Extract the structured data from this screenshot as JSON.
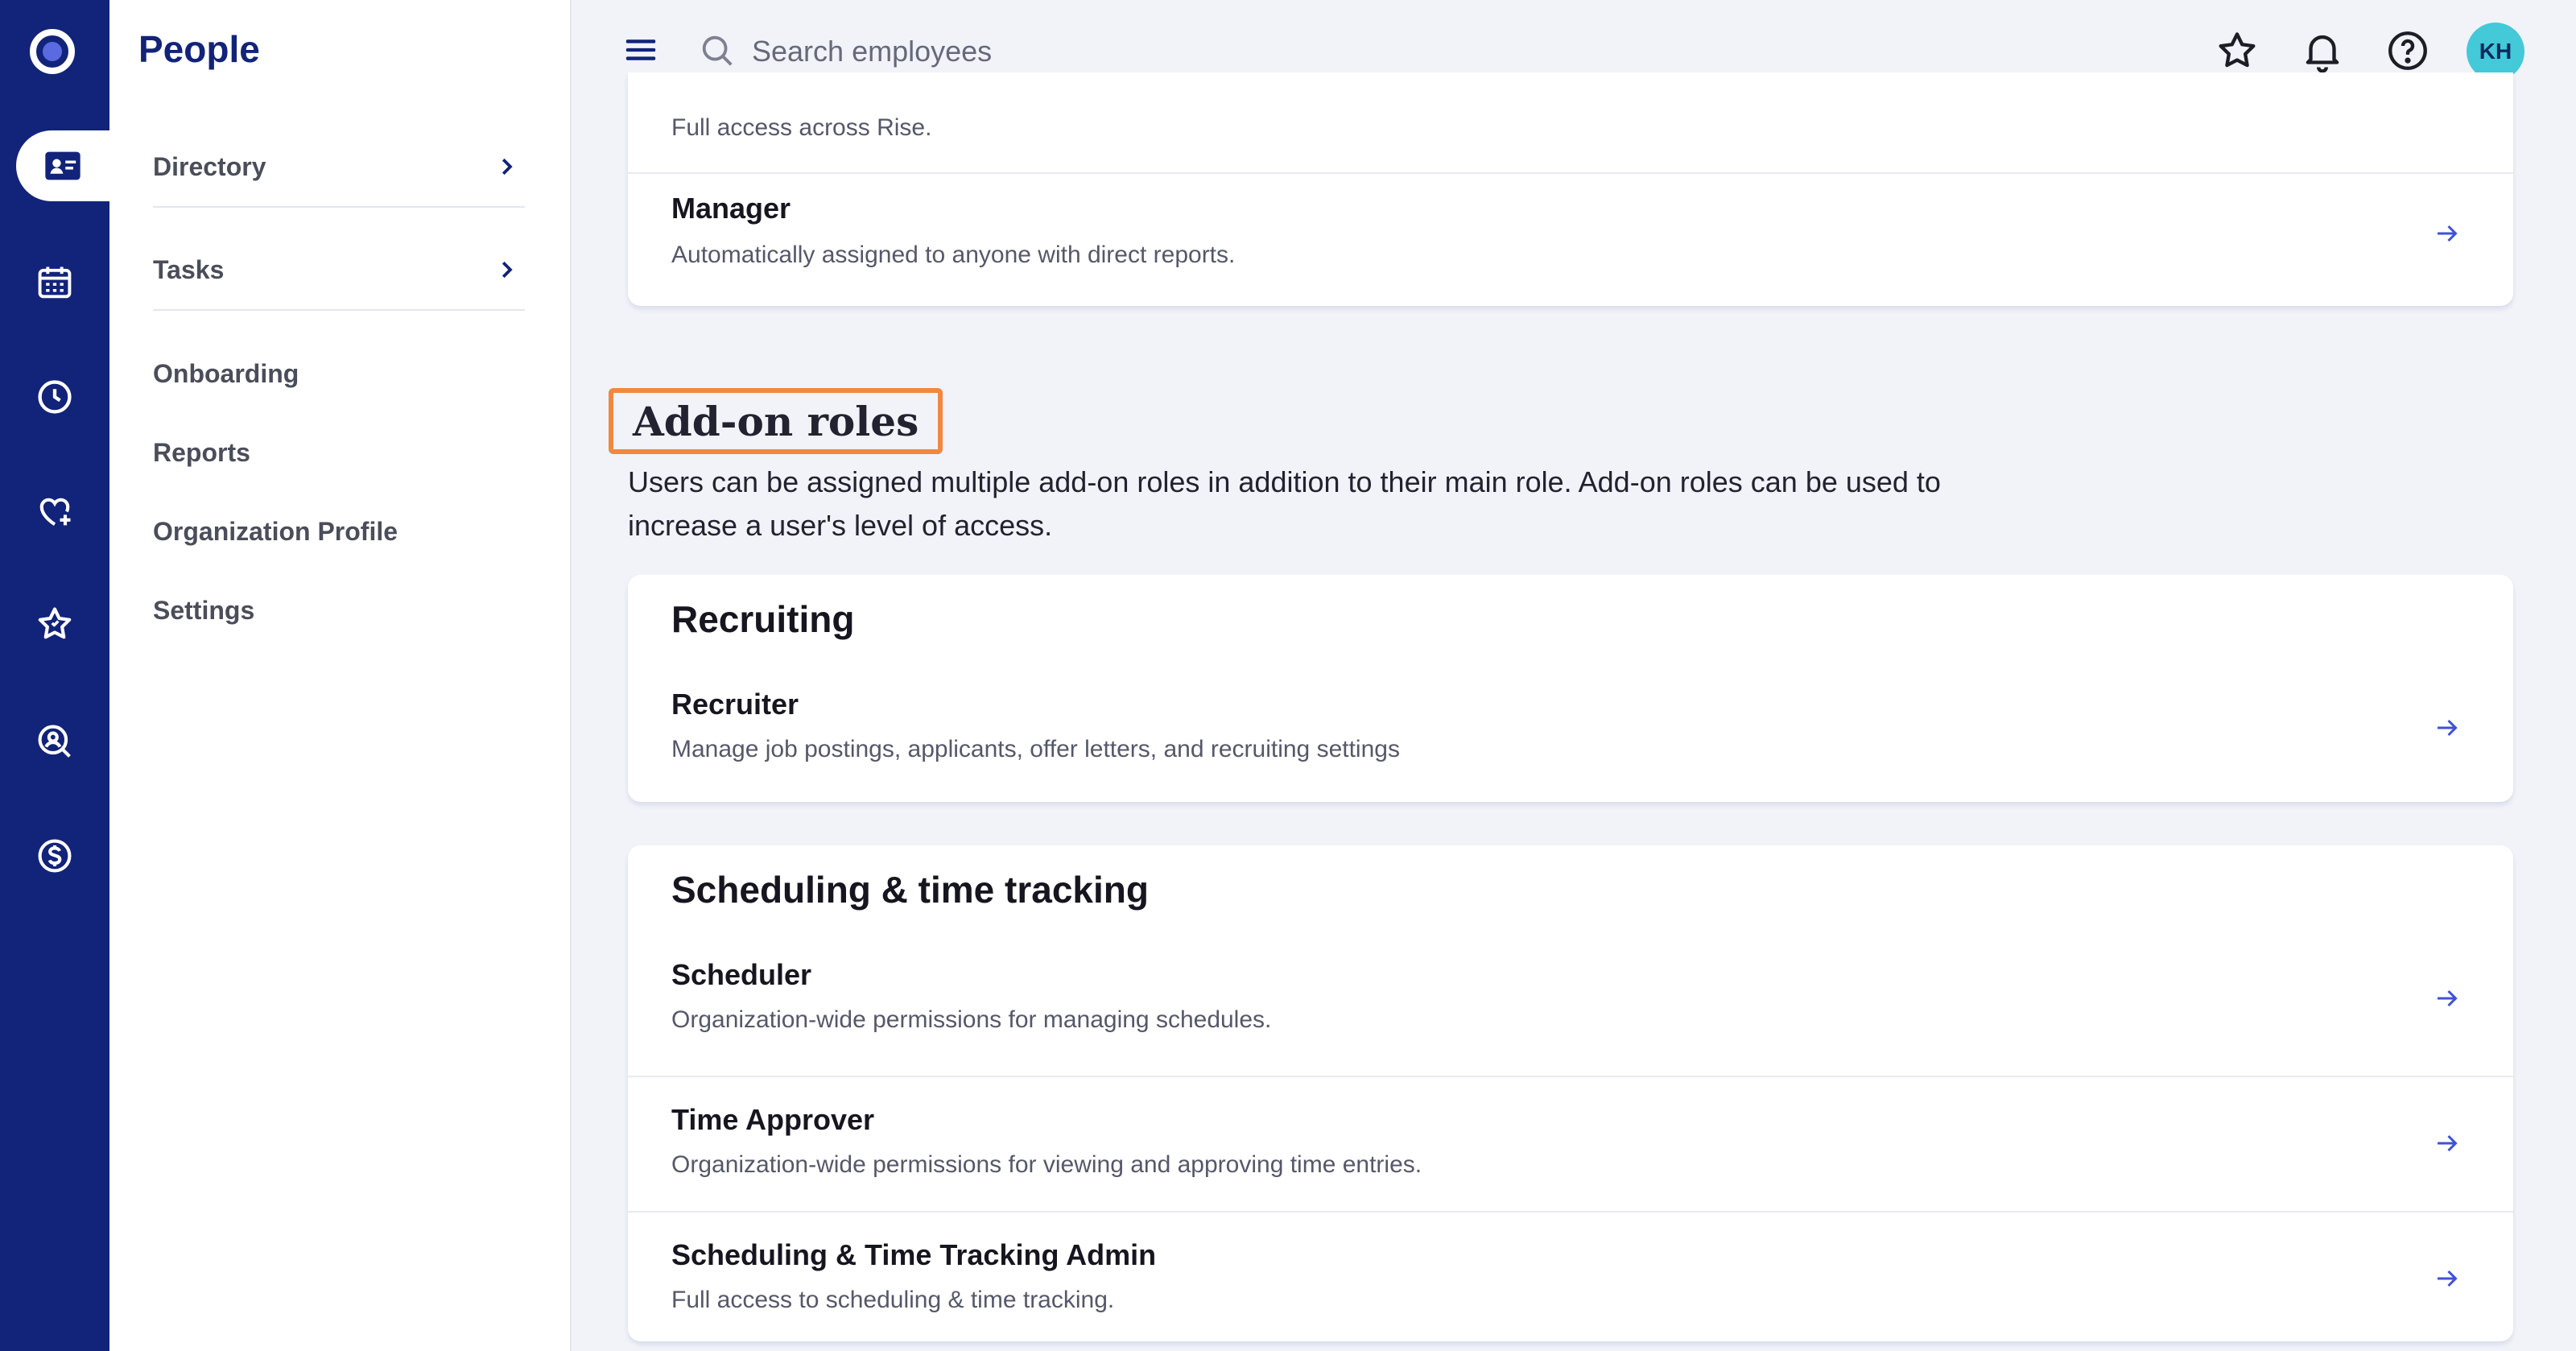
{
  "app": {
    "section_title": "People"
  },
  "rail": {
    "items": [
      {
        "icon": "people-card-icon",
        "active": true
      },
      {
        "icon": "calendar-icon"
      },
      {
        "icon": "clock-icon"
      },
      {
        "icon": "heart-plus-icon"
      },
      {
        "icon": "star-icon"
      },
      {
        "icon": "user-search-icon"
      },
      {
        "icon": "dollar-icon"
      }
    ]
  },
  "subnav": {
    "items": [
      {
        "label": "Directory",
        "has_children": true
      },
      {
        "label": "Tasks",
        "has_children": true
      },
      {
        "label": "Onboarding"
      },
      {
        "label": "Reports"
      },
      {
        "label": "Organization Profile"
      },
      {
        "label": "Settings"
      }
    ]
  },
  "topbar": {
    "search_placeholder": "Search employees",
    "avatar_initials": "KH",
    "icons": [
      "menu-icon",
      "search-icon",
      "favorites-star-icon",
      "bell-icon",
      "help-icon"
    ]
  },
  "main_roles": {
    "partial_desc": "Full access across Rise.",
    "manager": {
      "name": "Manager",
      "desc": "Automatically assigned to anyone with direct reports."
    }
  },
  "addon": {
    "heading": "Add-on roles",
    "description": "Users can be assigned multiple add-on roles in addition to their main role. Add-on roles can be used to increase a user's level of access.",
    "groups": [
      {
        "title": "Recruiting",
        "roles": [
          {
            "name": "Recruiter",
            "desc": "Manage job postings, applicants, offer letters, and recruiting settings"
          }
        ]
      },
      {
        "title": "Scheduling & time tracking",
        "roles": [
          {
            "name": "Scheduler",
            "desc": "Organization-wide permissions for managing schedules."
          },
          {
            "name": "Time Approver",
            "desc": "Organization-wide permissions for viewing and approving time entries."
          },
          {
            "name": "Scheduling & Time Tracking Admin",
            "desc": "Full access to scheduling & time tracking."
          }
        ]
      }
    ]
  },
  "colors": {
    "rail_bg": "#12237a",
    "accent_blue": "#3f51d9",
    "highlight_orange": "#f1883e",
    "avatar_teal": "#43c9d8"
  }
}
